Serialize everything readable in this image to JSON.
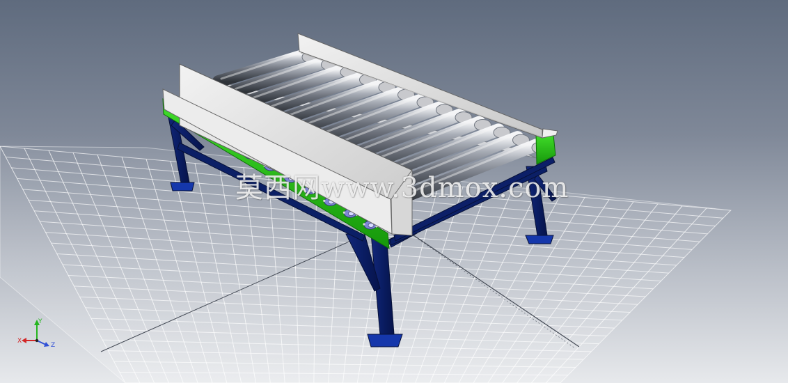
{
  "watermark": {
    "text": "莫西网www.3dmox.com"
  },
  "axis_triad": {
    "x": "X",
    "y": "Y",
    "z": "Z"
  },
  "colors": {
    "frame": "#0c1f68",
    "side_plate": "#2fc81a",
    "bearing": "#7e87d7",
    "guard": "#e1e1e1",
    "roller": "#8a8f98"
  }
}
